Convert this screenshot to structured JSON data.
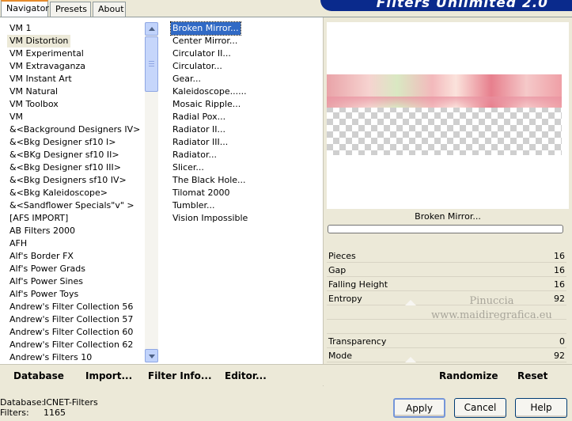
{
  "tabs": [
    "Navigator",
    "Presets",
    "About"
  ],
  "brand": "Filters Unlimited 2.0",
  "categories": [
    "VM 1",
    "VM Distortion",
    "VM Experimental",
    "VM Extravaganza",
    "VM Instant Art",
    "VM Natural",
    "VM Toolbox",
    "VM",
    "&<Background Designers IV>",
    "&<Bkg Designer sf10 I>",
    "&<BKg Designer sf10 II>",
    "&<Bkg Designer sf10 III>",
    "&<Bkg Designers sf10 IV>",
    "&<Bkg Kaleidoscope>",
    "&<Sandflower Specials\"v\" >",
    "[AFS IMPORT]",
    "AB Filters 2000",
    "AFH",
    "Alf's Border FX",
    "Alf's Power Grads",
    "Alf's Power Sines",
    "Alf's Power Toys",
    "Andrew's Filter Collection 56",
    "Andrew's Filter Collection 57",
    "Andrew's Filter Collection 60",
    "Andrew's Filter Collection 62",
    "Andrew's Filters 10"
  ],
  "selected_category": "VM Distortion",
  "filters": [
    "Broken Mirror...",
    "Center Mirror...",
    "Circulator II...",
    "Circulator...",
    "Gear...",
    "Kaleidoscope......",
    "Mosaic Ripple...",
    "Radial Pox...",
    "Radiator II...",
    "Radiator III...",
    "Radiator...",
    "Slicer...",
    "The Black Hole...",
    "Tilomat 2000",
    "Tumbler...",
    "Vision Impossible"
  ],
  "selected_filter": "Broken Mirror...",
  "filter_name": "Broken Mirror...",
  "params": [
    {
      "label": "Pieces",
      "value": "16"
    },
    {
      "label": "Gap",
      "value": "16"
    },
    {
      "label": "Falling Height",
      "value": "16"
    },
    {
      "label": "Entropy",
      "value": "92"
    },
    {
      "label": "Transparency",
      "value": "0"
    },
    {
      "label": "Mode",
      "value": "92"
    }
  ],
  "watermark": {
    "line1": "Pinuccia",
    "line2": "www.maidiregrafica.eu"
  },
  "bottom_buttons": {
    "database": "Database",
    "import": "Import...",
    "filter_info": "Filter Info...",
    "editor": "Editor...",
    "randomize": "Randomize",
    "reset": "Reset"
  },
  "status": {
    "database_label": "Database:",
    "database_value": "ICNET-Filters",
    "filters_label": "Filters:",
    "filters_value": "1165"
  },
  "dialog_buttons": {
    "apply": "Apply",
    "cancel": "Cancel",
    "help": "Help"
  }
}
